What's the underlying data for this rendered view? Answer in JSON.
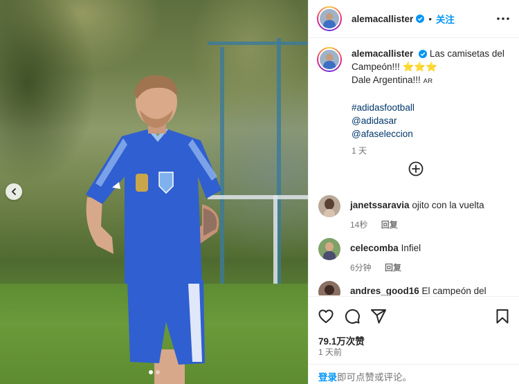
{
  "post": {
    "username": "alemacallister",
    "dot": "•",
    "follow_label": "关注",
    "caption": {
      "username": "alemacallister",
      "line1": "Las camisetas del Campeón!!!",
      "stars": "⭐⭐⭐",
      "line2": "Dale Argentina!!!",
      "flag_text": "AR",
      "tags": [
        "#adidasfootball",
        "@adidasar",
        "@afaseleccion"
      ],
      "time": "1 天"
    },
    "likes_count": "79.1万次赞",
    "posted_time": "1 天前"
  },
  "comments": [
    {
      "username": "janetssaravia",
      "text": "ojito con la vuelta",
      "time": "14秒",
      "reply_label": "回复"
    },
    {
      "username": "celecomba",
      "text": "Infiel",
      "time": "6分钟",
      "reply_label": "回复"
    },
    {
      "username": "andres_good16",
      "text": "El campeón del mundo",
      "time": "",
      "reply_label": ""
    }
  ],
  "footer": {
    "login_label": "登录",
    "rest": "即可点赞或评论。"
  },
  "colors": {
    "accent": "#0095f6",
    "link": "#00376b",
    "muted": "#737373",
    "text": "#262626",
    "jersey": "#2f5fd0"
  },
  "icons": {
    "verified": "verified-badge-icon",
    "more": "more-options-icon",
    "add": "add-circle-icon",
    "like": "heart-icon",
    "comment": "comment-icon",
    "share": "paper-plane-icon",
    "save": "bookmark-icon",
    "prev": "chevron-left-icon"
  },
  "carousel": {
    "slides": 2,
    "active": 0
  }
}
